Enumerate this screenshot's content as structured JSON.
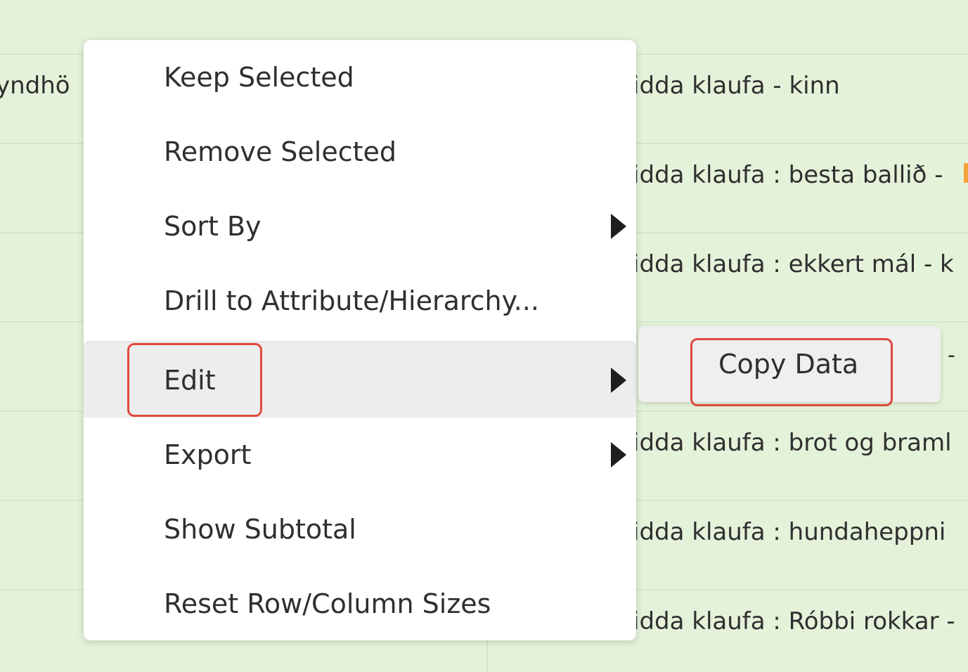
{
  "table": {
    "left_cell": "yndhö",
    "rows": [
      "idda klaufa - kinn",
      "idda klaufa : besta ballið -",
      "idda klaufa : ekkert mál - k",
      "-",
      "idda klaufa : brot og braml",
      "idda klaufa : hundaheppni",
      "idda klaufa : Róbbi rokkar -"
    ]
  },
  "context_menu": {
    "items": [
      {
        "label": "Keep Selected",
        "has_submenu": false
      },
      {
        "label": "Remove Selected",
        "has_submenu": false
      },
      {
        "label": "Sort By",
        "has_submenu": true
      },
      {
        "label": "Drill to Attribute/Hierarchy...",
        "has_submenu": false
      },
      {
        "label": "Edit",
        "has_submenu": true,
        "active": true
      },
      {
        "label": "Export",
        "has_submenu": true
      },
      {
        "label": "Show Subtotal",
        "has_submenu": false
      },
      {
        "label": "Reset Row/Column Sizes",
        "has_submenu": false
      }
    ]
  },
  "submenu": {
    "items": [
      {
        "label": "Copy Data"
      }
    ]
  },
  "colors": {
    "background": "#e4f2da",
    "active_item": "#ededed",
    "highlight": "#e0493e",
    "accent_mark": "#f2a23a"
  }
}
